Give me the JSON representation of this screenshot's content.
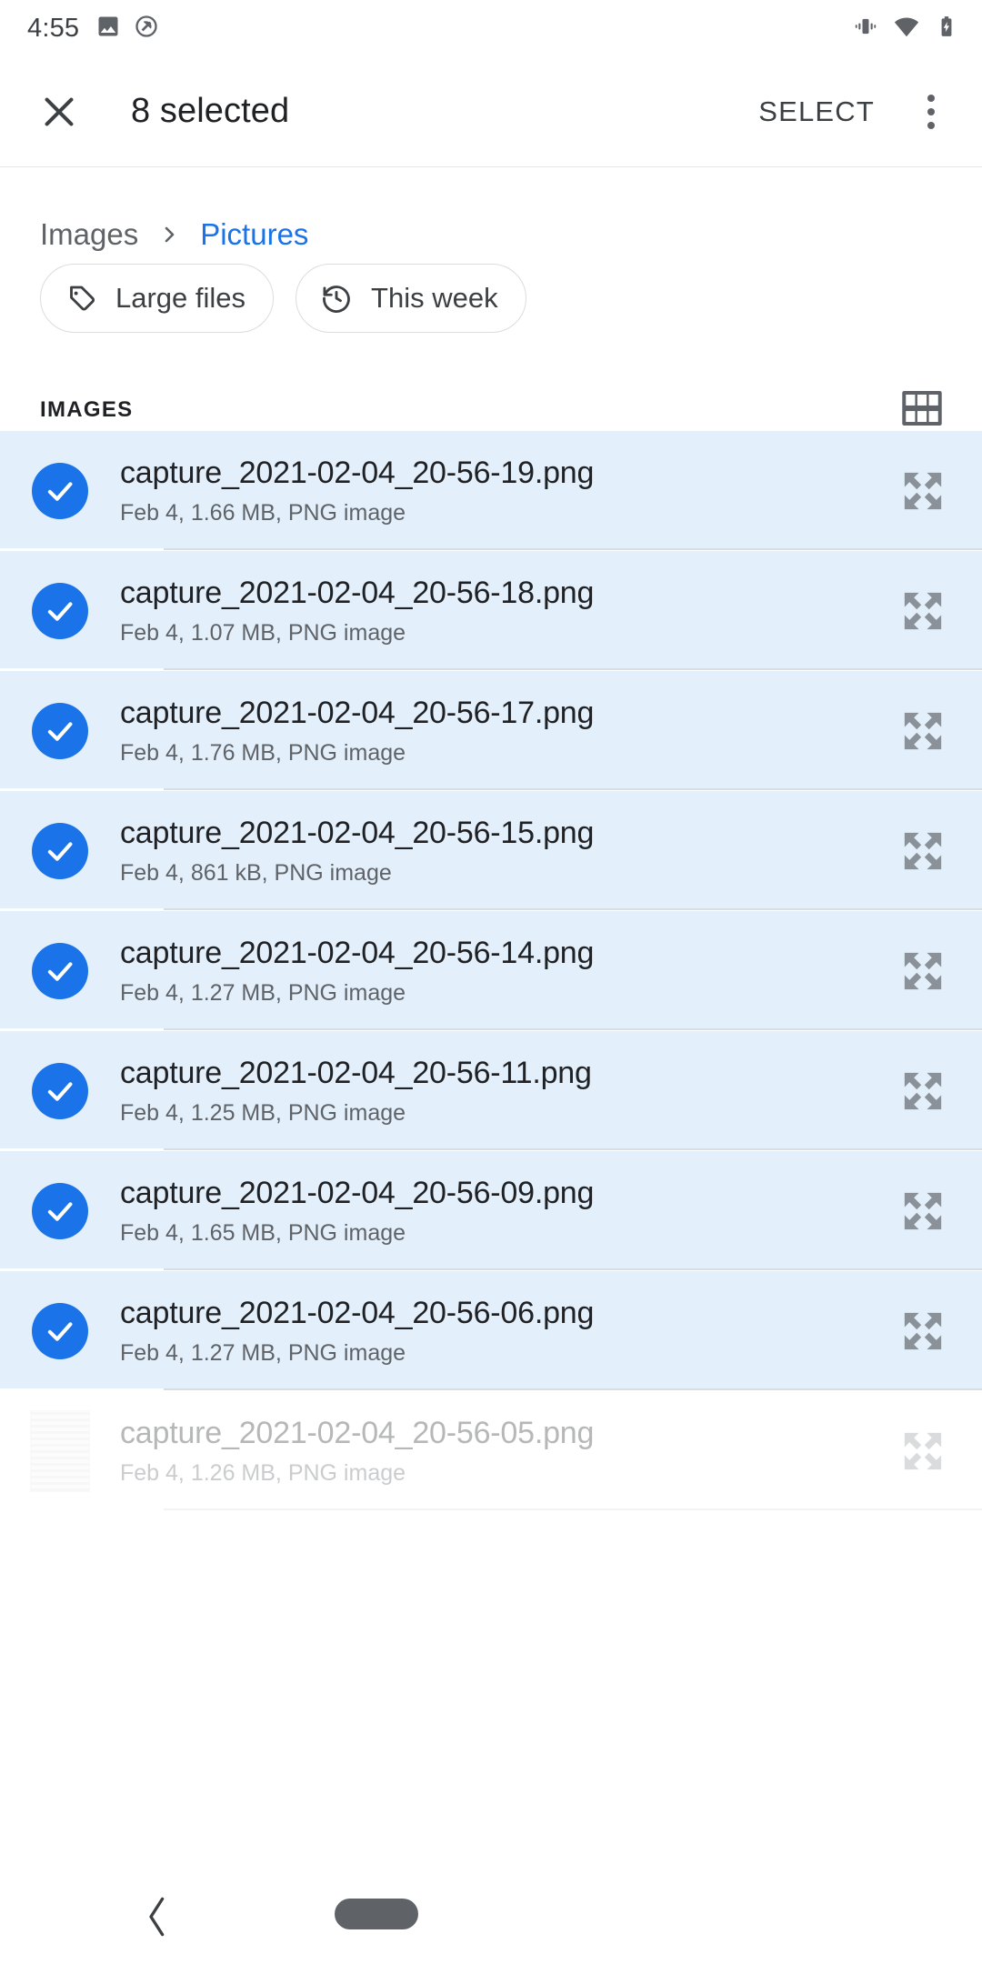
{
  "status_bar": {
    "time": "4:55",
    "left_icons": [
      "image-icon",
      "do-not-disturb-icon"
    ],
    "right_icons": [
      "vibrate-icon",
      "wifi-icon",
      "battery-charging-icon"
    ]
  },
  "toolbar": {
    "close_label": "close-icon",
    "title": "8 selected",
    "select_label": "SELECT",
    "overflow_label": "more-options-icon"
  },
  "breadcrumb": {
    "root": "Images",
    "separator": "chevron-right-icon",
    "current": "Pictures"
  },
  "chips": [
    {
      "label": "Large files",
      "icon": "tag-icon"
    },
    {
      "label": "This week",
      "icon": "history-icon"
    }
  ],
  "section": {
    "title": "IMAGES",
    "view_toggle": "grid-view-icon"
  },
  "colors": {
    "accent": "#1a73e8",
    "selected_row_bg": "#e3f0fb",
    "primary_text": "#202124",
    "secondary_text": "#5f6368",
    "divider": "#dcdcdc"
  },
  "files": [
    {
      "name": "capture_2021-02-04_20-56-19.png",
      "meta": "Feb 4, 1.66 MB, PNG image",
      "selected": true
    },
    {
      "name": "capture_2021-02-04_20-56-18.png",
      "meta": "Feb 4, 1.07 MB, PNG image",
      "selected": true
    },
    {
      "name": "capture_2021-02-04_20-56-17.png",
      "meta": "Feb 4, 1.76 MB, PNG image",
      "selected": true
    },
    {
      "name": "capture_2021-02-04_20-56-15.png",
      "meta": "Feb 4, 861 kB, PNG image",
      "selected": true
    },
    {
      "name": "capture_2021-02-04_20-56-14.png",
      "meta": "Feb 4, 1.27 MB, PNG image",
      "selected": true
    },
    {
      "name": "capture_2021-02-04_20-56-11.png",
      "meta": "Feb 4, 1.25 MB, PNG image",
      "selected": true
    },
    {
      "name": "capture_2021-02-04_20-56-09.png",
      "meta": "Feb 4, 1.65 MB, PNG image",
      "selected": true
    },
    {
      "name": "capture_2021-02-04_20-56-06.png",
      "meta": "Feb 4, 1.27 MB, PNG image",
      "selected": true
    },
    {
      "name": "capture_2021-02-04_20-56-05.png",
      "meta": "Feb 4, 1.26 MB, PNG image",
      "selected": false
    }
  ],
  "navigation": {
    "back_label": "back-chevron-icon",
    "home_pill_label": "gesture-nav-pill"
  }
}
